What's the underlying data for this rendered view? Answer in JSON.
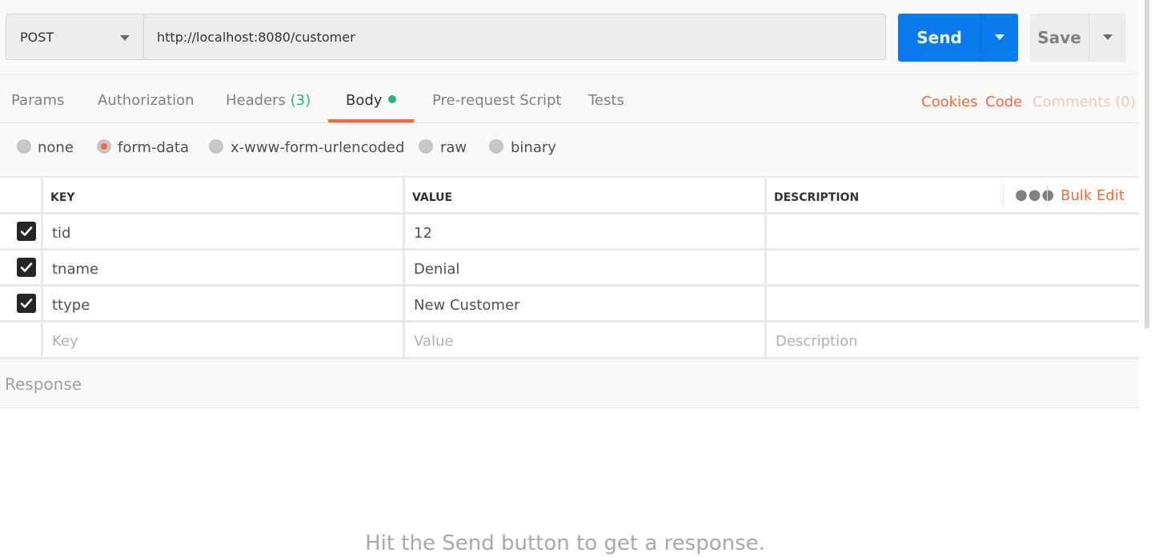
{
  "request": {
    "method": "POST",
    "url": "http://localhost:8080/customer",
    "send_label": "Send",
    "save_label": "Save"
  },
  "tabs": {
    "params": "Params",
    "authorization": "Authorization",
    "headers": "Headers",
    "headers_count": "(3)",
    "body": "Body",
    "pre_request": "Pre-request Script",
    "tests": "Tests",
    "cookies": "Cookies",
    "code": "Code",
    "comments": "Comments (0)"
  },
  "body_modes": {
    "none": "none",
    "form_data": "form-data",
    "urlencoded": "x-www-form-urlencoded",
    "raw": "raw",
    "binary": "binary",
    "selected": "form-data"
  },
  "table": {
    "headers": {
      "key": "KEY",
      "value": "VALUE",
      "description": "DESCRIPTION"
    },
    "bulk_edit": "Bulk Edit",
    "rows": [
      {
        "key": "tid",
        "value": "12",
        "description": "",
        "checked": true
      },
      {
        "key": "tname",
        "value": "Denial",
        "description": "",
        "checked": true
      },
      {
        "key": "ttype",
        "value": "New Customer",
        "description": "",
        "checked": true
      }
    ],
    "placeholders": {
      "key": "Key",
      "value": "Value",
      "description": "Description"
    }
  },
  "response": {
    "title": "Response",
    "empty_message": "Hit the Send button to get a response."
  },
  "colors": {
    "accent": "#f26b3a",
    "send_blue": "#097bed",
    "status_green": "#26b47f"
  },
  "icons": {
    "method_dropdown": "chevron-down-icon",
    "send_dropdown": "chevron-down-icon",
    "save_dropdown": "chevron-down-icon",
    "more": "ellipsis-icon",
    "checkbox": "check-icon"
  }
}
